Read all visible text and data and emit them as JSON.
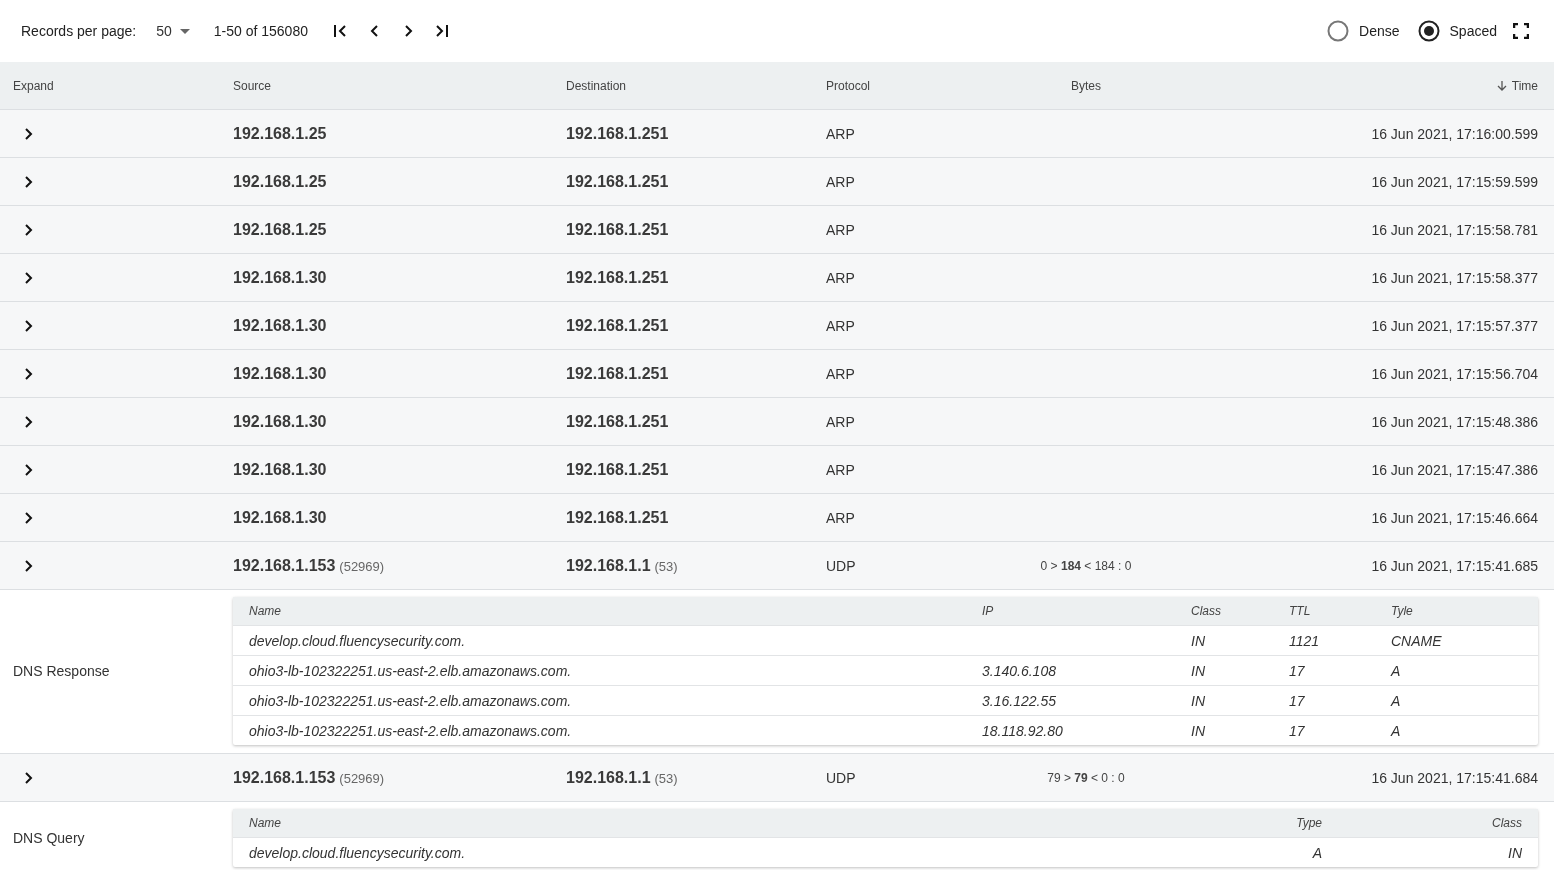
{
  "pager": {
    "label": "Records per page:",
    "page_size": "50",
    "range": "1-50 of 156080"
  },
  "density": [
    {
      "label": "Dense",
      "selected": false
    },
    {
      "label": "Spaced",
      "selected": true
    }
  ],
  "table": {
    "columns": [
      {
        "label": "Expand",
        "sorted": false
      },
      {
        "label": "Source",
        "sorted": false
      },
      {
        "label": "Destination",
        "sorted": false
      },
      {
        "label": "Protocol",
        "sorted": false
      },
      {
        "label": "Bytes",
        "sorted": false
      },
      {
        "label": "Time",
        "sorted": true
      }
    ],
    "rows": [
      {
        "source": "192.168.1.25",
        "destination": "192.168.1.251",
        "protocol": "ARP",
        "time": "16 Jun 2021, 17:16:00.599"
      },
      {
        "source": "192.168.1.25",
        "destination": "192.168.1.251",
        "protocol": "ARP",
        "time": "16 Jun 2021, 17:15:59.599"
      },
      {
        "source": "192.168.1.25",
        "destination": "192.168.1.251",
        "protocol": "ARP",
        "time": "16 Jun 2021, 17:15:58.781"
      },
      {
        "source": "192.168.1.30",
        "destination": "192.168.1.251",
        "protocol": "ARP",
        "time": "16 Jun 2021, 17:15:58.377"
      },
      {
        "source": "192.168.1.30",
        "destination": "192.168.1.251",
        "protocol": "ARP",
        "time": "16 Jun 2021, 17:15:57.377"
      },
      {
        "source": "192.168.1.30",
        "destination": "192.168.1.251",
        "protocol": "ARP",
        "time": "16 Jun 2021, 17:15:56.704"
      },
      {
        "source": "192.168.1.30",
        "destination": "192.168.1.251",
        "protocol": "ARP",
        "time": "16 Jun 2021, 17:15:48.386"
      },
      {
        "source": "192.168.1.30",
        "destination": "192.168.1.251",
        "protocol": "ARP",
        "time": "16 Jun 2021, 17:15:47.386"
      },
      {
        "source": "192.168.1.30",
        "destination": "192.168.1.251",
        "protocol": "ARP",
        "time": "16 Jun 2021, 17:15:46.664"
      },
      {
        "source": "192.168.1.153",
        "source_port": "(52969)",
        "destination": "192.168.1.1",
        "destination_port": "(53)",
        "protocol": "UDP",
        "bytes": "0 > **184** < 184 : 0",
        "time": "16 Jun 2021, 17:15:41.685",
        "detail": {
          "kind": "response",
          "label": "DNS Response",
          "columns": [
            "Name",
            "IP",
            "Class",
            "TTL",
            "Tyle"
          ],
          "rows": [
            [
              "develop.cloud.fluencysecurity.com.",
              "",
              "IN",
              "1121",
              "CNAME"
            ],
            [
              "ohio3-lb-102322251.us-east-2.elb.amazonaws.com.",
              "3.140.6.108",
              "IN",
              "17",
              "A"
            ],
            [
              "ohio3-lb-102322251.us-east-2.elb.amazonaws.com.",
              "3.16.122.55",
              "IN",
              "17",
              "A"
            ],
            [
              "ohio3-lb-102322251.us-east-2.elb.amazonaws.com.",
              "18.118.92.80",
              "IN",
              "17",
              "A"
            ]
          ]
        }
      },
      {
        "source": "192.168.1.153",
        "source_port": "(52969)",
        "destination": "192.168.1.1",
        "destination_port": "(53)",
        "protocol": "UDP",
        "bytes": "79 > **79** < 0 : 0",
        "time": "16 Jun 2021, 17:15:41.684",
        "detail": {
          "kind": "query",
          "label": "DNS Query",
          "columns": [
            "Name",
            "Type",
            "Class"
          ],
          "rows": [
            [
              "develop.cloud.fluencysecurity.com.",
              "A",
              "IN"
            ]
          ]
        }
      }
    ]
  }
}
